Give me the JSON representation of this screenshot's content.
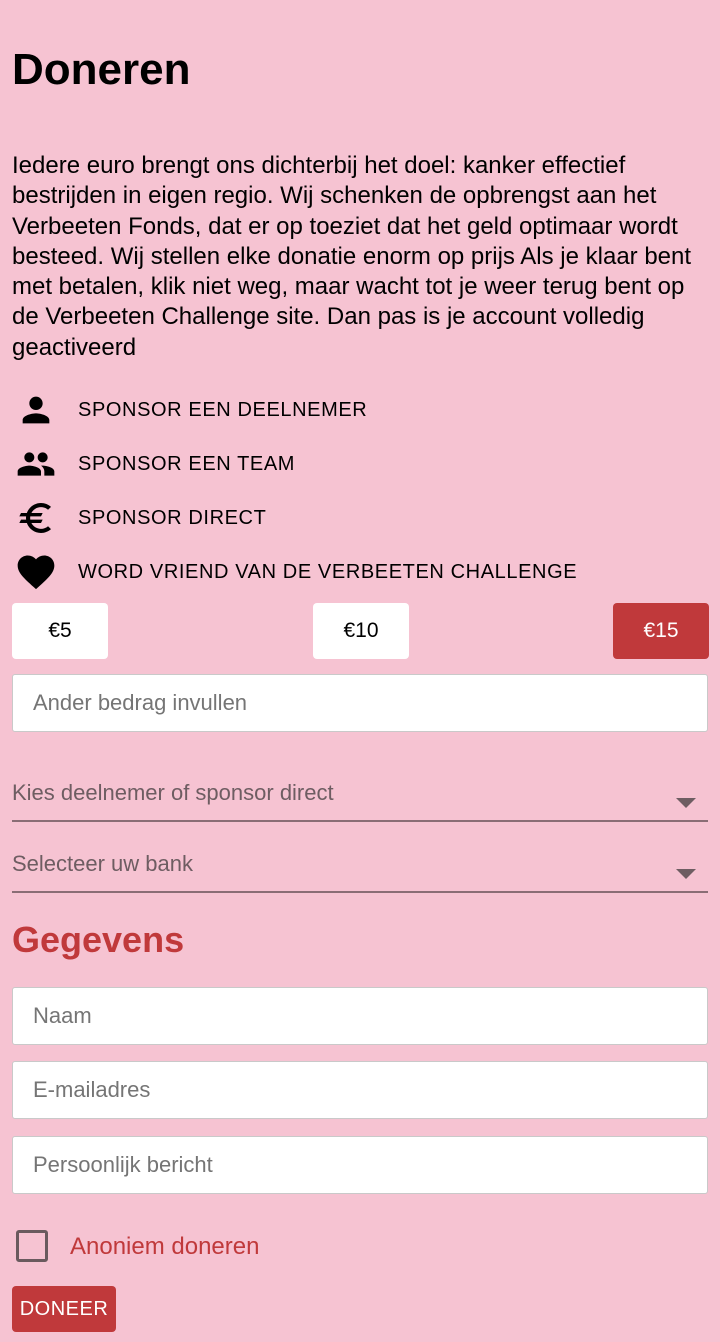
{
  "page": {
    "title": "Doneren",
    "intro": "Iedere euro brengt ons dichterbij het doel: kanker effectief bestrijden in eigen regio. Wij schenken de opbrengst aan het Verbeeten Fonds, dat er op toeziet dat het geld optimaar wordt besteed. Wij stellen elke donatie enorm op prijs Als je klaar bent met betalen, klik niet weg, maar wacht tot je weer terug bent op de Verbeeten Challenge site. Dan pas is je account volledig geactiveerd"
  },
  "options": [
    {
      "label": "SPONSOR EEN DEELNEMER",
      "icon": "person-icon"
    },
    {
      "label": "SPONSOR EEN TEAM",
      "icon": "group-icon"
    },
    {
      "label": "SPONSOR DIRECT",
      "icon": "euro-icon"
    },
    {
      "label": "WORD VRIEND VAN DE VERBEETEN CHALLENGE",
      "icon": "heart-icon"
    }
  ],
  "amounts": [
    {
      "label": "€5",
      "selected": false
    },
    {
      "label": "€10",
      "selected": false
    },
    {
      "label": "€15",
      "selected": true
    }
  ],
  "other_amount": {
    "placeholder": "Ander bedrag invullen"
  },
  "selects": {
    "participant": "Kies deelnemer of sponsor direct",
    "bank": "Selecteer uw bank"
  },
  "details": {
    "heading": "Gegevens",
    "name_placeholder": "Naam",
    "email_placeholder": "E-mailadres",
    "message_placeholder": "Persoonlijk bericht"
  },
  "anonymous": {
    "label": "Anoniem doneren",
    "checked": false
  },
  "submit": {
    "label": "DONEER"
  },
  "colors": {
    "background": "#f6c3d2",
    "accent": "#c0393b",
    "input_background": "#ffffff"
  }
}
